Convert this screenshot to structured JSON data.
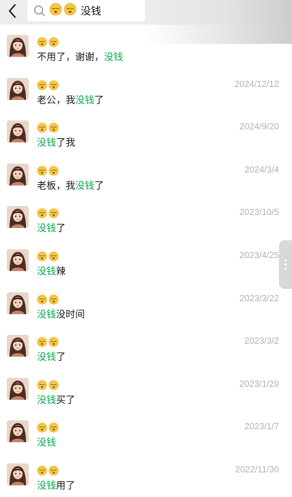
{
  "search": {
    "query_emojis": [
      "😴",
      "😴"
    ],
    "query_text": "没钱"
  },
  "results": [
    {
      "name_emojis": [
        "😴",
        "😴"
      ],
      "date": "",
      "pre": "不用了，谢谢，",
      "highlight": "没钱",
      "post": ""
    },
    {
      "name_emojis": [
        "😴",
        "😴"
      ],
      "date": "2024/12/12",
      "pre": "老公，我",
      "highlight": "没钱",
      "post": "了"
    },
    {
      "name_emojis": [
        "😴",
        "😴"
      ],
      "date": "2024/9/20",
      "pre": "",
      "highlight": "没钱",
      "post": "了我"
    },
    {
      "name_emojis": [
        "😴",
        "😴"
      ],
      "date": "2024/3/4",
      "pre": "老板，我",
      "highlight": "没钱",
      "post": "了"
    },
    {
      "name_emojis": [
        "😴",
        "😴"
      ],
      "date": "2023/10/5",
      "pre": "",
      "highlight": "没钱",
      "post": "了"
    },
    {
      "name_emojis": [
        "😴",
        "😴"
      ],
      "date": "2023/4/25",
      "pre": "",
      "highlight": "没钱",
      "post": "辣"
    },
    {
      "name_emojis": [
        "😴",
        "😴"
      ],
      "date": "2023/3/22",
      "pre": "",
      "highlight": "没钱",
      "post": "没时间"
    },
    {
      "name_emojis": [
        "😴",
        "😴"
      ],
      "date": "2023/3/2",
      "pre": "",
      "highlight": "没钱",
      "post": "了"
    },
    {
      "name_emojis": [
        "😴",
        "😴"
      ],
      "date": "2023/1/29",
      "pre": "",
      "highlight": "没钱",
      "post": "买了"
    },
    {
      "name_emojis": [
        "😴",
        "😴"
      ],
      "date": "2023/1/7",
      "pre": "",
      "highlight": "没钱",
      "post": ""
    },
    {
      "name_emojis": [
        "😴",
        "😴"
      ],
      "date": "2022/11/30",
      "pre": "",
      "highlight": "没钱",
      "post": "用了"
    }
  ],
  "colors": {
    "highlight": "#07a94b",
    "date": "#b2b2b2",
    "topbar": "#ededed"
  }
}
